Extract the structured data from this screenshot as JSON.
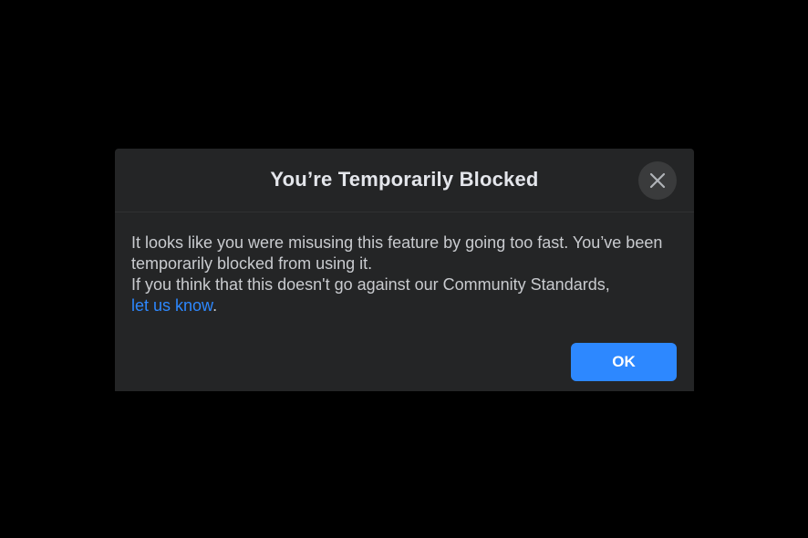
{
  "dialog": {
    "title": "You’re Temporarily Blocked",
    "close_icon": "close-icon",
    "message_line1": "It looks like you were misusing this feature by going too fast. You’ve been temporarily blocked from using it.",
    "message_line2": "If you think that this doesn't go against our Community Standards,",
    "link_text": "let us know",
    "link_suffix": ".",
    "ok_label": "OK"
  },
  "colors": {
    "background": "#000000",
    "dialog_bg": "#242526",
    "title": "#e4e6eb",
    "body_text": "#c9cbcf",
    "accent": "#2d88ff",
    "close_bg": "#3a3b3c"
  }
}
